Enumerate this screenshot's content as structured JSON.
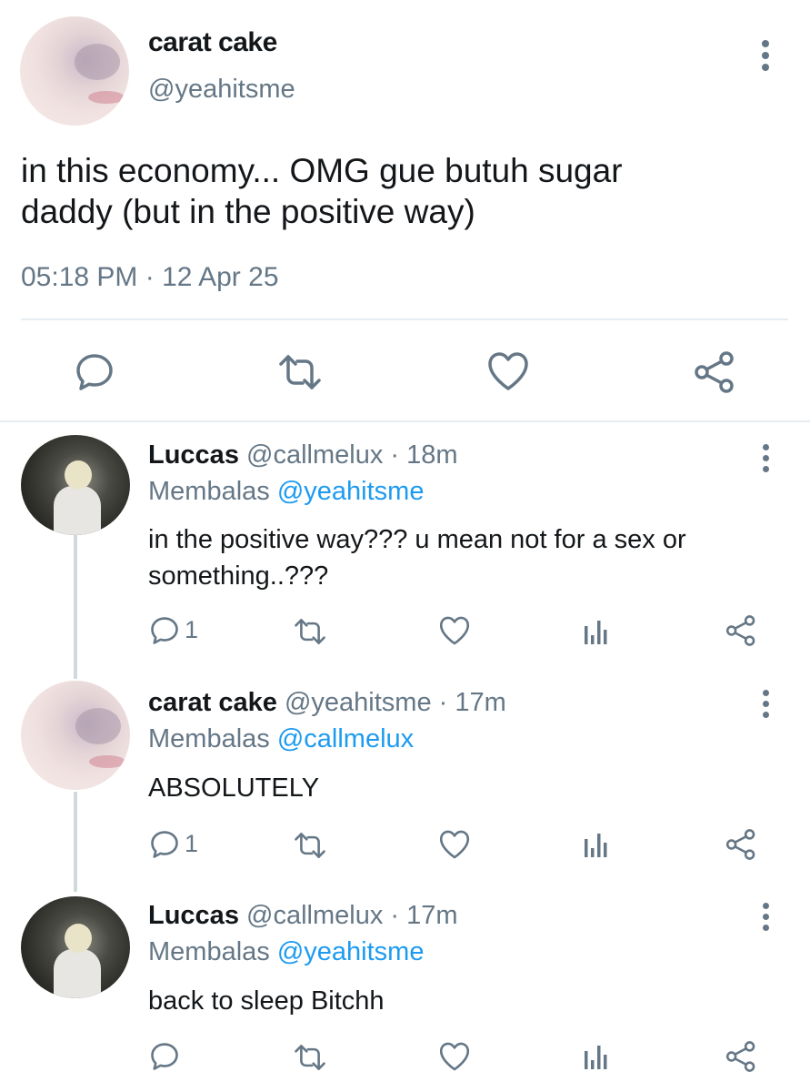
{
  "main_tweet": {
    "display_name": "carat cake",
    "handle": "@yeahitsme",
    "text_line1": "in this economy... OMG gue butuh sugar",
    "text_line2": "daddy (but in the positive way)",
    "timestamp": "05:18 PM · 12 Apr 25",
    "icons": [
      "more-icon",
      "reply-icon",
      "retweet-icon",
      "like-icon",
      "share-icon"
    ]
  },
  "replies": [
    {
      "display_name": "Luccas",
      "handle": "@callmelux",
      "time": "· 18m",
      "replying_label": "Membalas",
      "replying_to": "@yeahitsme",
      "text_line1": "in the positive way??? u mean not for a sex or",
      "text_line2": "something..???",
      "reply_count": "1"
    },
    {
      "display_name": "carat cake",
      "handle": "@yeahitsme",
      "time": "· 17m",
      "replying_label": "Membalas",
      "replying_to": "@callmelux",
      "text_line1": "ABSOLUTELY",
      "reply_count": "1"
    },
    {
      "display_name": "Luccas",
      "handle": "@callmelux",
      "time": "· 17m",
      "replying_label": "Membalas",
      "replying_to": "@yeahitsme",
      "text_line1": "back to sleep Bitchh",
      "reply_count": ""
    }
  ],
  "colors": {
    "accent": "#1d9bf0",
    "muted": "#657786",
    "text": "#14171a",
    "divider": "#e6ecf0"
  }
}
